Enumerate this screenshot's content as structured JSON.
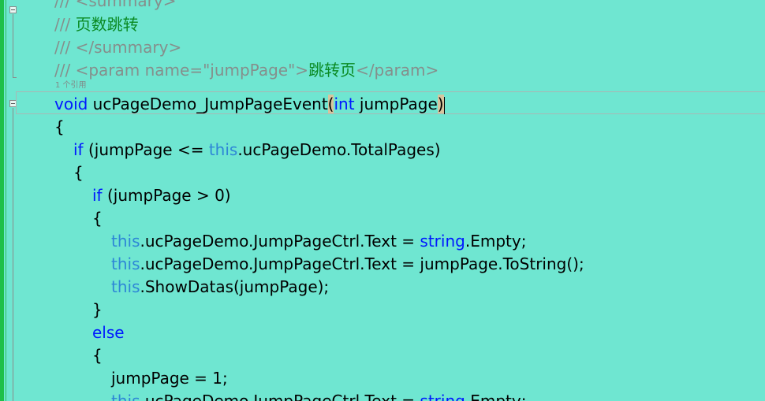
{
  "editor": {
    "lines": [
      {
        "indent": 0,
        "tokens": [
          {
            "c": "c",
            "t": "/// <summary>"
          }
        ]
      },
      {
        "indent": 0,
        "tokens": [
          {
            "c": "c",
            "t": "/// "
          },
          {
            "c": "cg",
            "t": "页数跳转"
          }
        ]
      },
      {
        "indent": 0,
        "tokens": [
          {
            "c": "c",
            "t": "/// </summary>"
          }
        ]
      },
      {
        "indent": 0,
        "tokens": [
          {
            "c": "c",
            "t": "/// <param name=\"jumpPage\">"
          },
          {
            "c": "cg",
            "t": "跳转页"
          },
          {
            "c": "c",
            "t": "</param>"
          }
        ]
      },
      {
        "indent": 0,
        "current": true,
        "tokens": [
          {
            "c": "k",
            "t": "void"
          },
          {
            "c": "",
            "t": " ucPageDemo_JumpPageEvent"
          },
          {
            "c": "brace-hl",
            "t": "("
          },
          {
            "c": "k",
            "t": "int"
          },
          {
            "c": "",
            "t": " jumpPage"
          },
          {
            "c": "brace-hl",
            "t": ")"
          },
          {
            "c": "caret",
            "t": ""
          }
        ]
      },
      {
        "indent": 0,
        "tokens": [
          {
            "c": "",
            "t": "{"
          }
        ]
      },
      {
        "indent": 1,
        "tokens": [
          {
            "c": "k",
            "t": "if"
          },
          {
            "c": "",
            "t": " (jumpPage <= "
          },
          {
            "c": "t",
            "t": "this"
          },
          {
            "c": "",
            "t": ".ucPageDemo.TotalPages)"
          }
        ]
      },
      {
        "indent": 1,
        "tokens": [
          {
            "c": "",
            "t": "{"
          }
        ]
      },
      {
        "indent": 2,
        "tokens": [
          {
            "c": "k",
            "t": "if"
          },
          {
            "c": "",
            "t": " (jumpPage > 0)"
          }
        ]
      },
      {
        "indent": 2,
        "tokens": [
          {
            "c": "",
            "t": "{"
          }
        ]
      },
      {
        "indent": 3,
        "tokens": [
          {
            "c": "t",
            "t": "this"
          },
          {
            "c": "",
            "t": ".ucPageDemo.JumpPageCtrl.Text = "
          },
          {
            "c": "k",
            "t": "string"
          },
          {
            "c": "",
            "t": ".Empty;"
          }
        ]
      },
      {
        "indent": 3,
        "tokens": [
          {
            "c": "t",
            "t": "this"
          },
          {
            "c": "",
            "t": ".ucPageDemo.JumpPageCtrl.Text = jumpPage.ToString();"
          }
        ]
      },
      {
        "indent": 3,
        "tokens": [
          {
            "c": "t",
            "t": "this"
          },
          {
            "c": "",
            "t": ".ShowDatas(jumpPage);"
          }
        ]
      },
      {
        "indent": 2,
        "tokens": [
          {
            "c": "",
            "t": "}"
          }
        ]
      },
      {
        "indent": 2,
        "tokens": [
          {
            "c": "k",
            "t": "else"
          }
        ]
      },
      {
        "indent": 2,
        "tokens": [
          {
            "c": "",
            "t": "{"
          }
        ]
      },
      {
        "indent": 3,
        "tokens": [
          {
            "c": "",
            "t": "jumpPage = 1;"
          }
        ]
      },
      {
        "indent": 3,
        "tokens": [
          {
            "c": "t",
            "t": "this"
          },
          {
            "c": "",
            "t": ".ucPageDemo.JumpPageCtrl.Text = "
          },
          {
            "c": "k",
            "t": "string"
          },
          {
            "c": "",
            "t": ".Empty;"
          }
        ]
      }
    ],
    "codelens": "1 个引用"
  }
}
